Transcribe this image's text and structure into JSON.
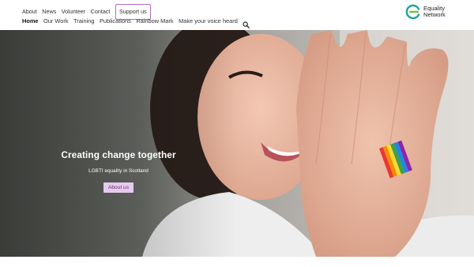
{
  "top_nav": {
    "items": [
      "About",
      "News",
      "Volunteer",
      "Contact"
    ],
    "support_label": "Support us"
  },
  "main_nav": {
    "items": [
      "Home",
      "Our Work",
      "Training",
      "Publications",
      "Rainbow Mark",
      "Make your voice heard"
    ],
    "active": "Home"
  },
  "logo": {
    "line1": "Equality",
    "line2": "Network"
  },
  "hero": {
    "title": "Creating change together",
    "subtitle": "LGBTI equality in Scotland",
    "button_label": "About us"
  },
  "colors": {
    "accent": "#8a2d93",
    "button_bg": "#e6cbef",
    "logo_teal": "#1fa39a",
    "logo_green": "#7cc04a"
  },
  "icons": {
    "search": "search-icon"
  }
}
